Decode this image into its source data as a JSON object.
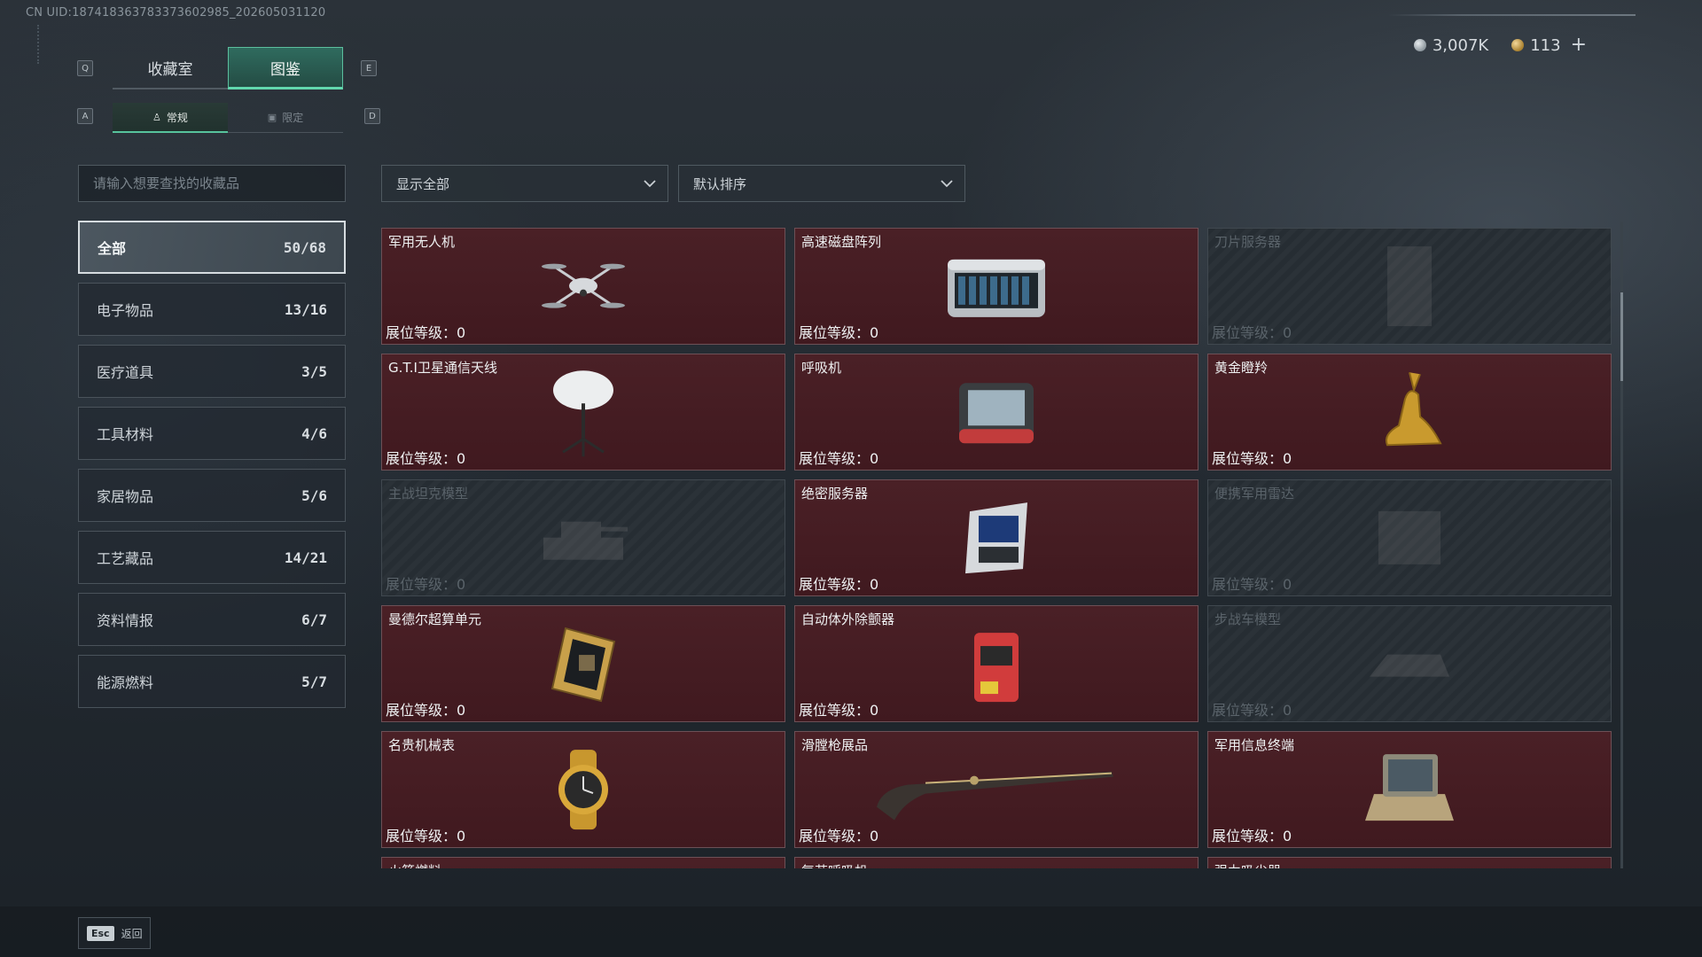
{
  "uid": "CN UID:18741836378337360298​5_202605031120",
  "currency": {
    "silver_amount": "3,007K",
    "gold_amount": "113",
    "add_symbol": "+"
  },
  "keys": {
    "tab_prev": "Q",
    "tab_next": "E",
    "sub_prev": "A",
    "sub_next": "D"
  },
  "tabs": [
    {
      "label": "收藏室",
      "active": false
    },
    {
      "label": "图鉴",
      "active": true
    }
  ],
  "subtabs": [
    {
      "label": "常规",
      "icon": "figure-icon",
      "active": true
    },
    {
      "label": "限定",
      "icon": "picture-icon",
      "active": false
    }
  ],
  "search": {
    "placeholder": "请输入想要查找的收藏品",
    "value": ""
  },
  "categories": [
    {
      "label": "全部",
      "count": "50/68",
      "active": true
    },
    {
      "label": "电子物品",
      "count": "13/16",
      "active": false
    },
    {
      "label": "医疗道具",
      "count": "3/5",
      "active": false
    },
    {
      "label": "工具材料",
      "count": "4/6",
      "active": false
    },
    {
      "label": "家居物品",
      "count": "5/6",
      "active": false
    },
    {
      "label": "工艺藏品",
      "count": "14/21",
      "active": false
    },
    {
      "label": "资料情报",
      "count": "6/7",
      "active": false
    },
    {
      "label": "能源燃料",
      "count": "5/7",
      "active": false
    }
  ],
  "filters": {
    "show": "显示全部",
    "sort": "默认排序"
  },
  "level_label": "展位等级：",
  "items": [
    {
      "name": "军用无人机",
      "level": "0",
      "collected": true,
      "icon": "drone-icon"
    },
    {
      "name": "高速磁盘阵列",
      "level": "0",
      "collected": true,
      "icon": "disk-array-icon"
    },
    {
      "name": "刀片服务器",
      "level": "0",
      "collected": false,
      "icon": "blade-server-icon"
    },
    {
      "name": "G.T.I卫星通信天线",
      "level": "0",
      "collected": true,
      "icon": "satellite-dish-icon"
    },
    {
      "name": "呼吸机",
      "level": "0",
      "collected": true,
      "icon": "ventilator-icon"
    },
    {
      "name": "黄金瞪羚",
      "level": "0",
      "collected": true,
      "icon": "golden-gazelle-icon"
    },
    {
      "name": "主战坦克模型",
      "level": "0",
      "collected": false,
      "icon": "tank-model-icon"
    },
    {
      "name": "绝密服务器",
      "level": "0",
      "collected": true,
      "icon": "secret-server-icon"
    },
    {
      "name": "便携军用雷达",
      "level": "0",
      "collected": false,
      "icon": "radar-icon"
    },
    {
      "name": "曼德尔超算单元",
      "level": "0",
      "collected": true,
      "icon": "supercomputer-unit-icon"
    },
    {
      "name": "自动体外除颤器",
      "level": "0",
      "collected": true,
      "icon": "defibrillator-icon"
    },
    {
      "name": "步战车模型",
      "level": "0",
      "collected": false,
      "icon": "ifv-model-icon"
    },
    {
      "name": "名贵机械表",
      "level": "0",
      "collected": true,
      "icon": "watch-icon"
    },
    {
      "name": "滑膛枪展品",
      "level": "0",
      "collected": true,
      "icon": "musket-icon"
    },
    {
      "name": "军用信息终端",
      "level": "0",
      "collected": true,
      "icon": "terminal-icon"
    },
    {
      "name": "火箭燃料",
      "level": "",
      "collected": true,
      "icon": "rocket-fuel-icon"
    },
    {
      "name": "复苏呼吸机",
      "level": "",
      "collected": true,
      "icon": "resuscitator-icon"
    },
    {
      "name": "强力吸尘器",
      "level": "",
      "collected": true,
      "icon": "vacuum-icon"
    }
  ],
  "footer": {
    "esc_key": "Esc",
    "back_label": "返回"
  }
}
